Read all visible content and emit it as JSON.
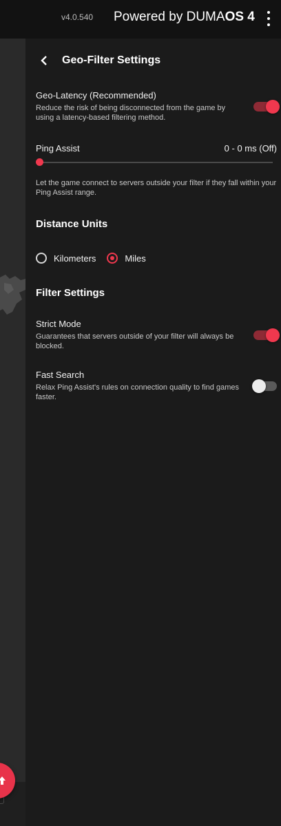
{
  "topbar": {
    "version": "v4.0.540",
    "brand_prefix": "Powered by DUMA",
    "brand_bold": "OS 4",
    "menu_icon": "kebab-menu-icon"
  },
  "page": {
    "title": "Geo-Filter Settings",
    "back_icon": "chevron-left-icon"
  },
  "geo_latency": {
    "title": "Geo-Latency (Recommended)",
    "description": "Reduce the risk of being disconnected from the game by using a latency-based filtering method.",
    "enabled": true
  },
  "ping_assist": {
    "title": "Ping Assist",
    "value": "0 - 0 ms  (Off)",
    "slider_level": 0,
    "description": "Let the game connect to servers outside your filter if they fall within your Ping Assist range."
  },
  "distance_units": {
    "title": "Distance Units",
    "options": [
      "Kilometers",
      "Miles"
    ],
    "selected": "Miles"
  },
  "filter_settings": {
    "title": "Filter Settings",
    "strict_mode": {
      "title": "Strict Mode",
      "description": "Guarantees that servers outside of your filter will always be blocked.",
      "enabled": true
    },
    "fast_search": {
      "title": "Fast Search",
      "description": "Relax Ping Assist's rules on connection quality to find games faster.",
      "enabled": false
    }
  },
  "colors": {
    "accent": "#f0384e",
    "background": "#1b1b1b",
    "topbar": "#121212"
  },
  "fab": {
    "icon": "arrow-up-icon"
  }
}
